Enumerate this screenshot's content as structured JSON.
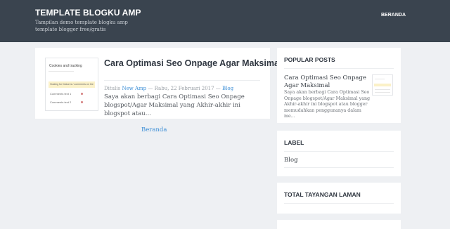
{
  "header": {
    "site_title": "TEMPLATE BLOGKU AMP",
    "site_description": "Tampilan demo template blogku amp template blogger free/gratis",
    "nav": {
      "home_label": "BERANDA"
    }
  },
  "post": {
    "title": "Cara Optimasi Seo Onpage Agar Maksimal",
    "meta": {
      "prefix": "Ditulis",
      "author": "New Amp",
      "separator_1": "—",
      "date": "Rabu, 22 Februari 2017",
      "separator_2": "—",
      "category": "Blog"
    },
    "excerpt": "Saya akan berbagi Cara Optimasi Seo Onpage blogspot/Agar Maksimal yang Akhir-akhir ini blogspot atau...",
    "thumbnail": {
      "heading": "Cookies and tracking",
      "band_text": "Hosting for features / comments on the",
      "row1": "Comments text 1",
      "row2": "Comments text 2"
    }
  },
  "pager": {
    "home_label": "Beranda"
  },
  "sidebar": {
    "popular": {
      "title": "POPULAR POSTS",
      "item_title": "Cara Optimasi Seo Onpage Agar Maksimal",
      "item_snippet": "Saya akan berbagi Cara Optimasi Seo Onpage blogspot/Agar Maksimal yang Akhir-akhir ini blogspot atau blogger memudahkan penggunanya dalam me..."
    },
    "label": {
      "title": "LABEL",
      "items": [
        "Blog"
      ]
    },
    "stats": {
      "title": "TOTAL TAYANGAN LAMAN"
    }
  },
  "colors": {
    "header_bg": "#3a444f",
    "page_bg": "#eef0f3",
    "link": "#3b8ed6",
    "title_text": "#2f3640"
  }
}
